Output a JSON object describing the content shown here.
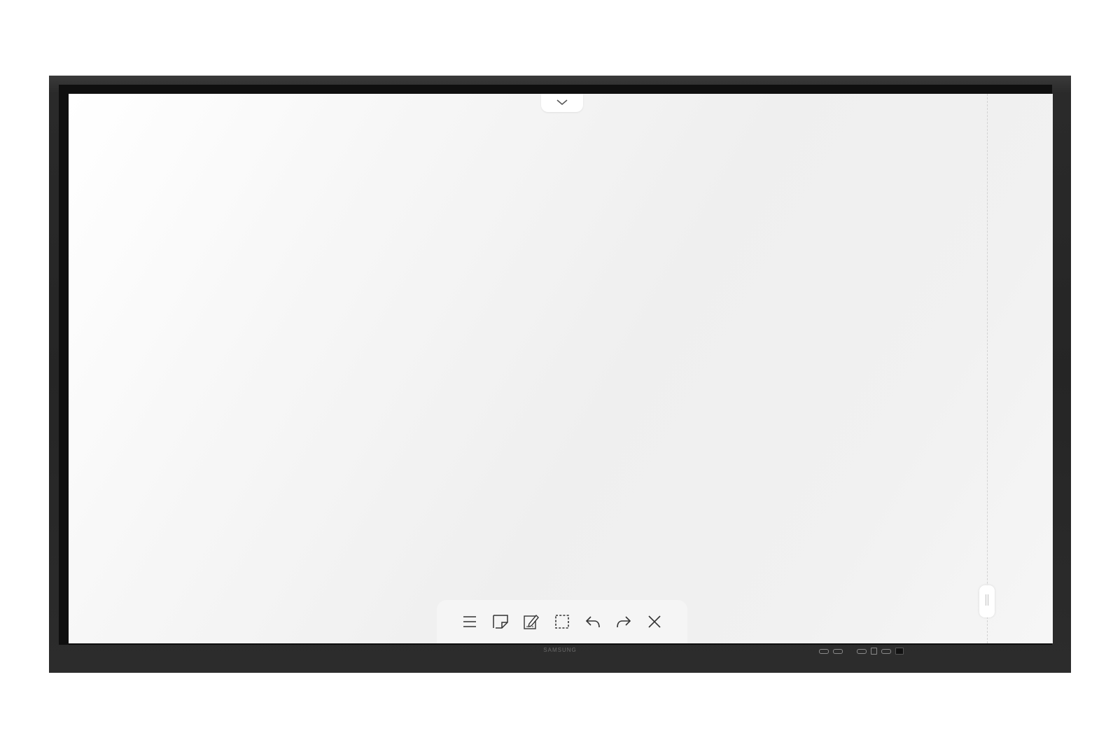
{
  "device": {
    "brand_label": "SAMSUNG",
    "bezel_color": "#252525"
  },
  "screen": {
    "background_color": "#f2f2f2"
  },
  "top_tab": {
    "icon": "chevron-down-icon"
  },
  "side_handle": {
    "icon": "drag-handle-icon"
  },
  "toolbar": {
    "items": [
      {
        "name": "menu",
        "icon": "hamburger-menu-icon"
      },
      {
        "name": "sticky-note",
        "icon": "sticky-note-icon"
      },
      {
        "name": "edit",
        "icon": "edit-pencil-icon"
      },
      {
        "name": "select",
        "icon": "dashed-selection-icon"
      },
      {
        "name": "undo",
        "icon": "undo-arrow-icon"
      },
      {
        "name": "redo",
        "icon": "redo-arrow-icon"
      },
      {
        "name": "close",
        "icon": "close-x-icon"
      }
    ]
  }
}
